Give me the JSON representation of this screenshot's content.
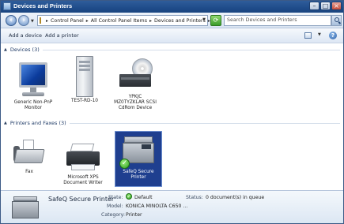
{
  "window": {
    "title": "Devices and Printers"
  },
  "address": {
    "crumbs": [
      "Control Panel",
      "All Control Panel Items",
      "Devices and Printers"
    ],
    "search_placeholder": "Search Devices and Printers"
  },
  "toolbar": {
    "add_device": "Add a device",
    "add_printer": "Add a printer"
  },
  "groups": {
    "devices": {
      "label": "Devices (3)",
      "items": [
        {
          "caption_lines": [
            "Generic Non-PnP",
            "Monitor"
          ],
          "icon": "monitor-icon"
        },
        {
          "caption_lines": [
            "TEST-RD-10"
          ],
          "icon": "computer-tower-icon"
        },
        {
          "caption_lines": [
            "YPKJC",
            "MZ0TYZKLAR SCSI",
            "CdRom Device"
          ],
          "icon": "cdrom-icon"
        }
      ]
    },
    "printers": {
      "label": "Printers and Faxes (3)",
      "items": [
        {
          "caption_lines": [
            "Fax"
          ],
          "icon": "fax-icon"
        },
        {
          "caption_lines": [
            "Microsoft XPS",
            "Document Writer"
          ],
          "icon": "printer-icon"
        },
        {
          "caption_lines": [
            "SafeQ Secure",
            "Printer"
          ],
          "icon": "multifunction-printer-icon",
          "selected": true,
          "default": true
        }
      ]
    }
  },
  "details": {
    "name": "SafeQ Secure Printer",
    "state_label": "State:",
    "state_value": "Default",
    "status_label": "Status:",
    "status_value": "0 document(s) in queue",
    "model_label": "Model:",
    "model_value": "KONICA MINOLTA C650 ...",
    "category_label": "Category:",
    "category_value": "Printer"
  },
  "colors": {
    "titlebar": "#1f4c8a",
    "selection": "#1f3f8f",
    "group_header_text": "#1e3a66"
  }
}
